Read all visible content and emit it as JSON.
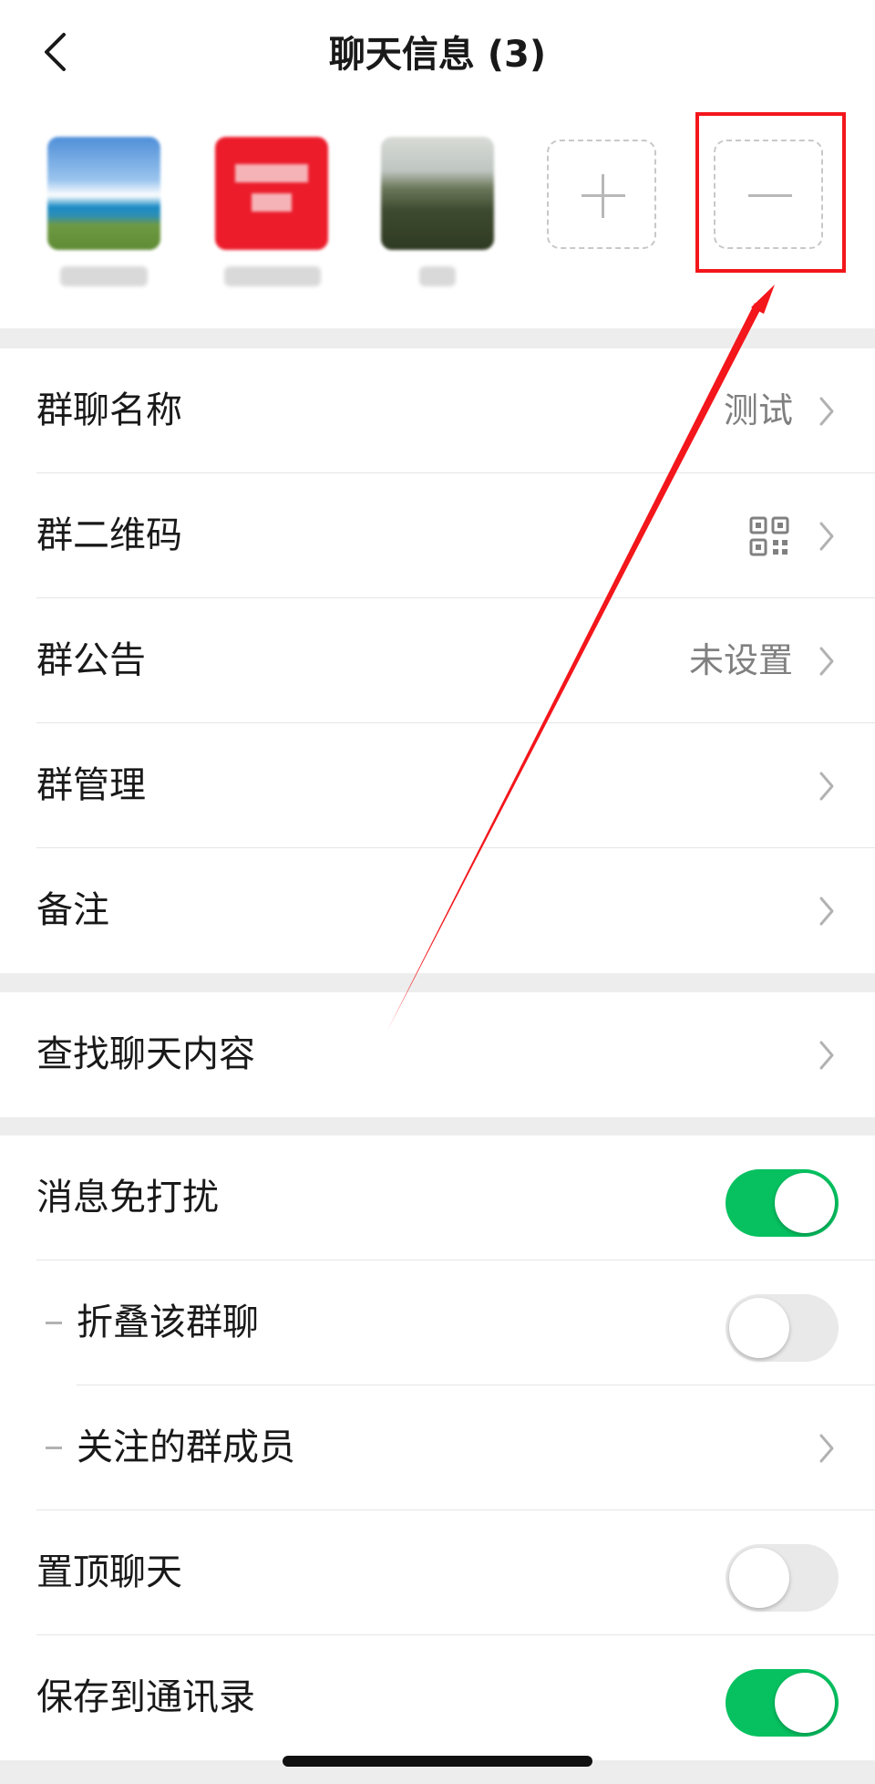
{
  "nav": {
    "title": "聊天信息 (3)"
  },
  "members": {
    "add_icon": "plus-icon",
    "remove_icon": "minus-icon"
  },
  "section1": [
    {
      "label": "群聊名称",
      "value": "测试"
    },
    {
      "label": "群二维码",
      "icon": "qr-code-icon"
    },
    {
      "label": "群公告",
      "value": "未设置"
    },
    {
      "label": "群管理"
    },
    {
      "label": "备注"
    }
  ],
  "section2": [
    {
      "label": "查找聊天内容"
    }
  ],
  "section3": [
    {
      "label": "消息免打扰",
      "toggle": true
    },
    {
      "label": "折叠该群聊",
      "toggle": false
    },
    {
      "label": "关注的群成员"
    },
    {
      "label": "置顶聊天",
      "toggle": false
    },
    {
      "label": "保存到通讯录",
      "toggle": true
    }
  ],
  "colors": {
    "accent_green": "#07c160",
    "annotation_red": "#f3161b"
  }
}
